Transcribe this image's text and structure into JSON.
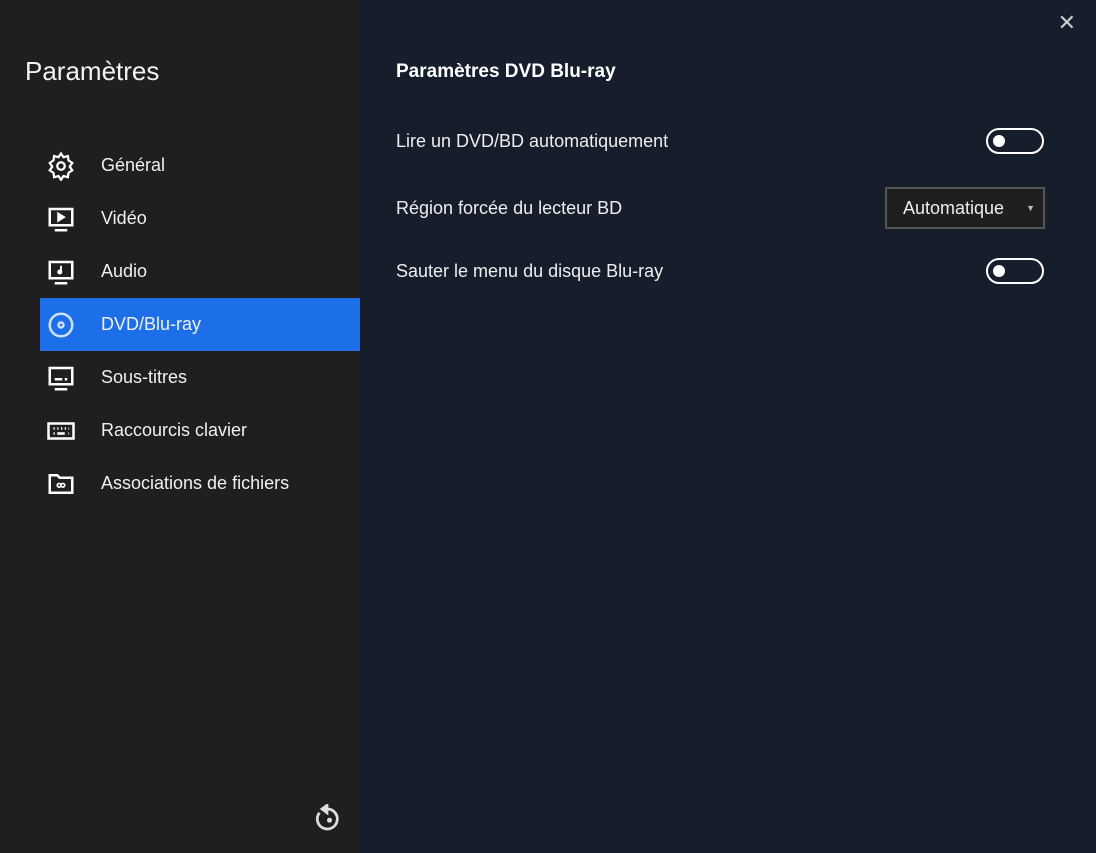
{
  "sidebar": {
    "title": "Paramètres",
    "items": [
      {
        "label": "Général",
        "icon": "gear-icon"
      },
      {
        "label": "Vidéo",
        "icon": "video-icon"
      },
      {
        "label": "Audio",
        "icon": "audio-icon"
      },
      {
        "label": "DVD/Blu-ray",
        "icon": "disc-icon",
        "active": true
      },
      {
        "label": "Sous-titres",
        "icon": "subtitles-icon"
      },
      {
        "label": "Raccourcis clavier",
        "icon": "keyboard-icon"
      },
      {
        "label": "Associations de fichiers",
        "icon": "folder-link-icon"
      }
    ]
  },
  "main": {
    "title": "Paramètres DVD Blu-ray",
    "settings": [
      {
        "label": "Lire un DVD/BD automatiquement",
        "type": "toggle",
        "value": false
      },
      {
        "label": "Région forcée du lecteur BD",
        "type": "select",
        "value": "Automatique"
      },
      {
        "label": "Sauter le menu du disque Blu-ray",
        "type": "toggle",
        "value": false
      }
    ]
  },
  "colors": {
    "accent": "#1c6fe8",
    "sidebar": "#1f1f1f",
    "main": "#171e2b"
  }
}
